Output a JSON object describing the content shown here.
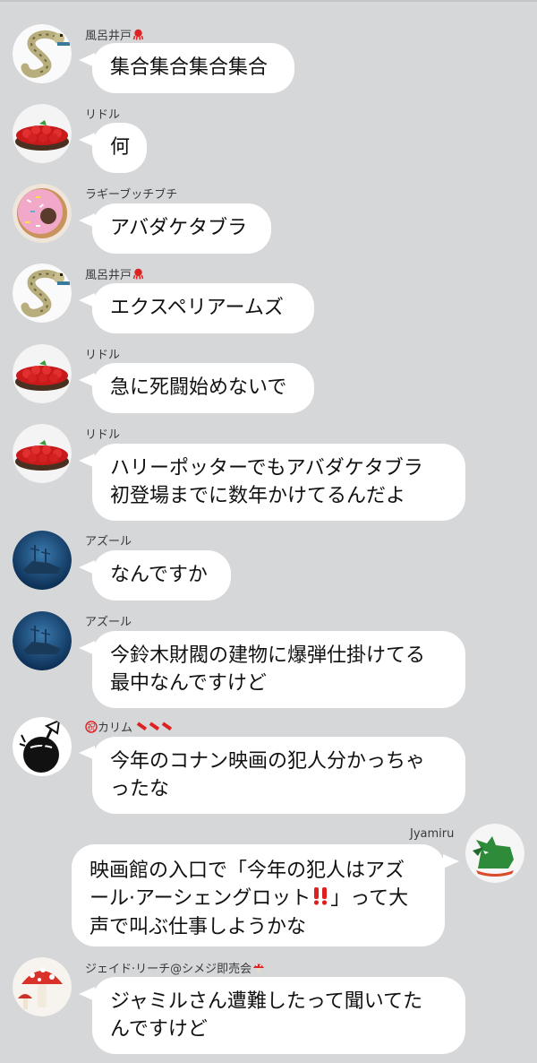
{
  "messages": [
    {
      "sender": "風呂井戸",
      "sender_icon": "octopus-icon",
      "avatar": "snake-avatar",
      "lines": [
        "集合集合集合集合"
      ]
    },
    {
      "sender": "リドル",
      "avatar": "strawberry-tart-avatar",
      "lines": [
        "何"
      ]
    },
    {
      "sender": "ラギーブッチブチ",
      "avatar": "donut-avatar",
      "lines": [
        "アバダケタブラ"
      ]
    },
    {
      "sender": "風呂井戸",
      "sender_icon": "octopus-icon",
      "avatar": "snake-avatar",
      "lines": [
        "エクスペリアームズ"
      ]
    },
    {
      "sender": "リドル",
      "avatar": "strawberry-tart-avatar",
      "lines": [
        "急に死闘始めないで"
      ]
    },
    {
      "sender": "リドル",
      "avatar": "strawberry-tart-avatar",
      "lines": [
        "ハリーポッターでもアバダケタブラ",
        "初登場までに数年かけてるんだよ"
      ]
    },
    {
      "sender": "アズール",
      "avatar": "shipwreck-avatar",
      "lines": [
        "なんですか"
      ]
    },
    {
      "sender": "アズール",
      "avatar": "shipwreck-avatar",
      "lines": [
        "今鈴木財閥の建物に爆弾仕掛けてる",
        "最中なんですけど"
      ]
    },
    {
      "sender": "カリム",
      "sender_prefix_icon": "celebrate-icon",
      "sender_suffix_icons": "firecrackers-icon",
      "avatar": "coconut-drink-avatar",
      "lines": [
        "今年のコナン映画の犯人分かっちゃ",
        "ったな"
      ]
    },
    {
      "sender": "Jyamiru",
      "avatar": "green-wolf-avatar",
      "lines": [
        "映画館の入口で「今年の犯人はアズ",
        "ール·アーシェングロット",
        "」って大",
        "声で叫ぶ仕事しようかな"
      ]
    },
    {
      "sender": "ジェイド·リーチ@シメジ即売会",
      "sender_icon": "mushroom-icon",
      "avatar": "mushroom-avatar",
      "lines": [
        "ジャミルさん遭難したって聞いてた",
        "んですけど"
      ]
    }
  ],
  "colors": {
    "background": "#d6d7d9",
    "bubble": "#ffffff",
    "text": "#111111",
    "accent_red": "#e02020"
  }
}
